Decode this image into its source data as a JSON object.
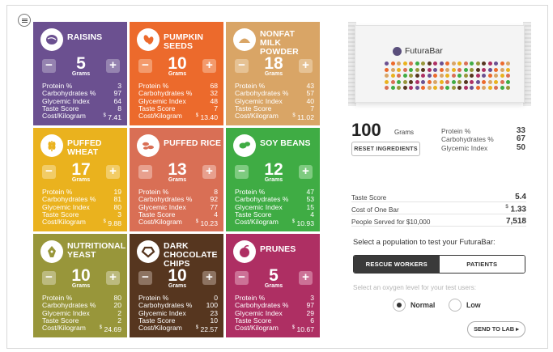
{
  "menu": {
    "icon": "hamburger-menu-icon"
  },
  "ingredients": [
    {
      "id": "raisins",
      "name": "RAISINS",
      "icon": "raisin-icon",
      "color": "#6b5090",
      "btn": "#9583b0",
      "grams": "5",
      "unit": "Grams",
      "protein": "3",
      "carbs": "97",
      "glycemic": "64",
      "taste": "8",
      "cost": "7.41"
    },
    {
      "id": "pumpkin-seeds",
      "name": "PUMPKIN SEEDS",
      "icon": "pumpkin-seed-icon",
      "color": "#ec6a2c",
      "btn": "#f39a6c",
      "grams": "10",
      "unit": "Grams",
      "protein": "68",
      "carbs": "32",
      "glycemic": "48",
      "taste": "7",
      "cost": "13.40"
    },
    {
      "id": "nonfat-milk-powder",
      "name": "NONFAT MILK POWDER",
      "icon": "milk-powder-icon",
      "color": "#d9a566",
      "btn": "#e6c294",
      "grams": "18",
      "unit": "Grams",
      "protein": "43",
      "carbs": "57",
      "glycemic": "40",
      "taste": "7",
      "cost": "11.02"
    },
    {
      "id": "puffed-wheat",
      "name": "PUFFED WHEAT",
      "icon": "wheat-icon",
      "color": "#eab21e",
      "btn": "#f2cc66",
      "grams": "17",
      "unit": "Grams",
      "protein": "19",
      "carbs": "81",
      "glycemic": "80",
      "taste": "3",
      "cost": "9.88"
    },
    {
      "id": "puffed-rice",
      "name": "PUFFED RICE",
      "icon": "rice-icon",
      "color": "#d96f55",
      "btn": "#e8a08e",
      "grams": "13",
      "unit": "Grams",
      "protein": "8",
      "carbs": "92",
      "glycemic": "77",
      "taste": "4",
      "cost": "10.23"
    },
    {
      "id": "soy-beans",
      "name": "SOY BEANS",
      "icon": "soy-bean-icon",
      "color": "#3fac44",
      "btn": "#7ecb80",
      "grams": "12",
      "unit": "Grams",
      "protein": "47",
      "carbs": "53",
      "glycemic": "15",
      "taste": "4",
      "cost": "10.93"
    },
    {
      "id": "nutritional-yeast",
      "name": "NUTRITIONAL YEAST",
      "icon": "yeast-icon",
      "color": "#98963a",
      "btn": "#bcba7e",
      "grams": "10",
      "unit": "Grams",
      "protein": "80",
      "carbs": "20",
      "glycemic": "2",
      "taste": "2",
      "cost": "24.69"
    },
    {
      "id": "dark-chocolate-chips",
      "name": "DARK CHOCOLATE CHIPS",
      "icon": "chocolate-icon",
      "color": "#56361f",
      "btn": "#8d7361",
      "grams": "10",
      "unit": "Grams",
      "protein": "0",
      "carbs": "100",
      "glycemic": "23",
      "taste": "10",
      "cost": "22.57"
    },
    {
      "id": "prunes",
      "name": "PRUNES",
      "icon": "prune-icon",
      "color": "#ae2f63",
      "btn": "#cc7196",
      "grams": "5",
      "unit": "Grams",
      "protein": "3",
      "carbs": "97",
      "glycemic": "29",
      "taste": "6",
      "cost": "10.67"
    }
  ],
  "labels": {
    "protein": "Protein %",
    "carbs": "Carbohydrates %",
    "glycemic": "Glycemic Index",
    "taste": "Taste Score",
    "cost": "Cost/Kilogram",
    "currency": "$",
    "minus": "−",
    "plus": "+"
  },
  "bar": {
    "brand": "FuturaBar",
    "dot_colors": [
      "#6b5090",
      "#ec6a2c",
      "#d9a566",
      "#eab21e",
      "#d96f55",
      "#3fac44",
      "#98963a",
      "#56361f",
      "#ae2f63"
    ]
  },
  "summary": {
    "total": "100",
    "total_unit": "Grams",
    "reset_label": "RESET INGREDIENTS",
    "protein_label": "Protein %",
    "protein": "33",
    "carbs_label": "Carbohydrates %",
    "carbs": "67",
    "glycemic_label": "Glycemic Index",
    "glycemic": "50"
  },
  "results": {
    "taste_label": "Taste Score",
    "taste": "5.4",
    "cost_label": "Cost of One Bar",
    "cost": "1.33",
    "served_label": "People Served for $10,000",
    "served": "7,518"
  },
  "population": {
    "title": "Select a population to test your FuturaBar:",
    "option1": "RESCUE WORKERS",
    "option2": "PATIENTS",
    "selected": "RESCUE WORKERS"
  },
  "oxygen": {
    "prompt": "Select an oxygen level for your test users:",
    "normal": "Normal",
    "low": "Low",
    "selected": "Normal"
  },
  "send_label": "SEND TO LAB ▸"
}
